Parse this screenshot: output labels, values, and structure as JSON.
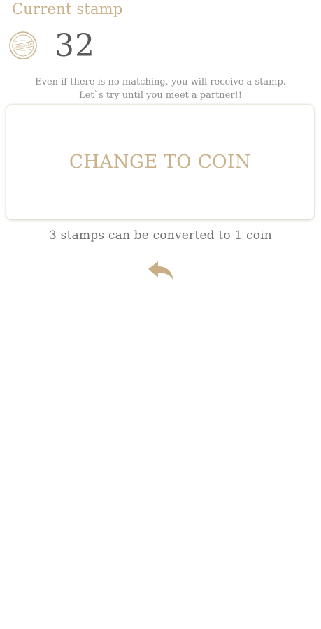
{
  "header": {
    "title": "Current stamp"
  },
  "stamp": {
    "icon": "stamp-icon",
    "icon_text": "APPROVED",
    "count": "32"
  },
  "info": {
    "line1": "Even if there is no matching, you will receive a stamp.",
    "line2": "Let`s try until you meet a partner!!"
  },
  "convert": {
    "button_label": "CHANGE TO COIN",
    "rate_text": "3  stamps can be converted to 1 coin"
  },
  "nav": {
    "back_icon": "back-arrow-icon"
  },
  "colors": {
    "accent": "#c9b28b",
    "text_dark": "#5a5a5a",
    "text_muted": "#8d8d8d"
  }
}
